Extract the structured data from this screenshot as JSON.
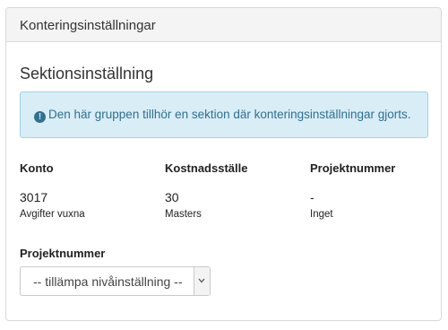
{
  "panel": {
    "title": "Konteringsinställningar"
  },
  "section": {
    "title": "Sektionsinställning",
    "alert_icon": "info-circle-icon",
    "alert_text": "Den här gruppen tillhör en sektion där konteringsinställningar gjorts."
  },
  "columns": [
    {
      "header": "Konto",
      "value": "3017",
      "sub": "Avgifter vuxna"
    },
    {
      "header": "Kostnadsställe",
      "value": "30",
      "sub": "Masters"
    },
    {
      "header": "Projektnummer",
      "value": "-",
      "sub": "Inget"
    }
  ],
  "project_field": {
    "label": "Projektnummer",
    "selected": "-- tillämpa nivåinställning --"
  }
}
